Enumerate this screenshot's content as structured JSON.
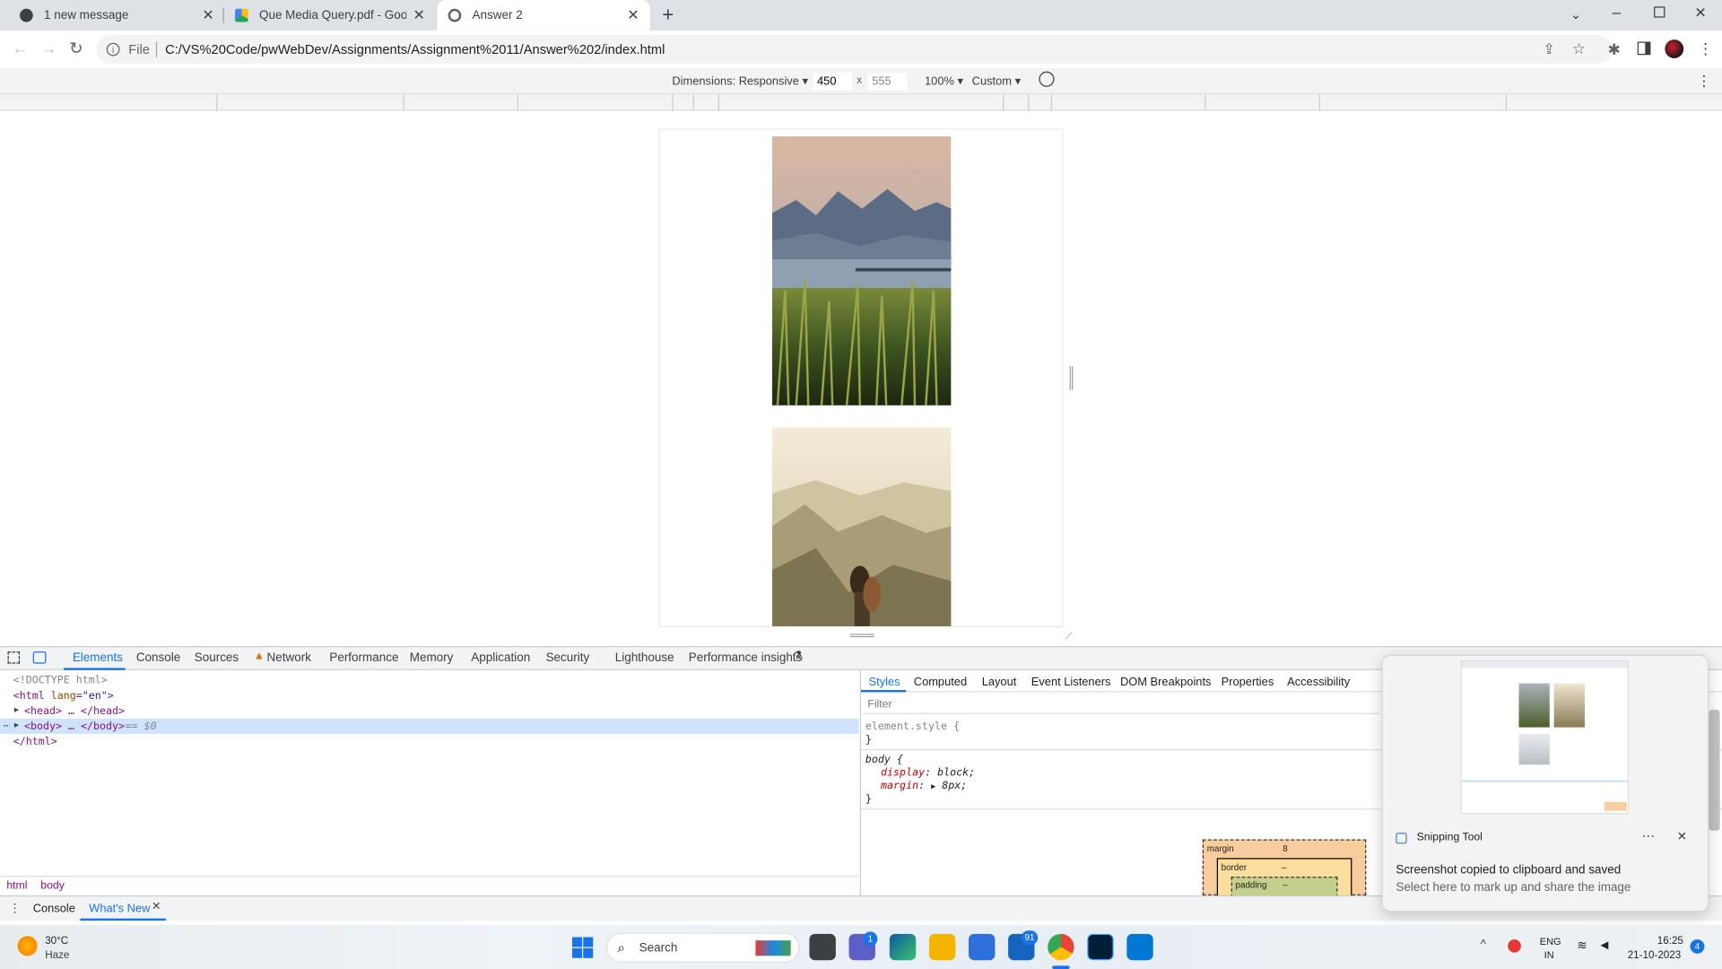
{
  "browser": {
    "tabs": [
      {
        "title": "1 new message",
        "favicon_color": "#3c4043"
      },
      {
        "title": "Que Media Query.pdf - Google D",
        "favicon_color": "#1fa463"
      },
      {
        "title": "Answer 2",
        "favicon_color": "#5f6368"
      }
    ],
    "new_tab_label": "+",
    "address": {
      "scheme_label": "File",
      "url": "C:/VS%20Code/pwWebDev/Assignments/Assignment%2011/Answer%202/index.html"
    }
  },
  "device_toolbar": {
    "dimensions_label": "Dimensions: Responsive",
    "width_value": "450",
    "times": "x",
    "height_value": "555",
    "zoom_label": "100%",
    "throttle_label": "Custom"
  },
  "devtools": {
    "tabs": [
      "Elements",
      "Console",
      "Sources",
      "Network",
      "Performance",
      "Memory",
      "Application",
      "Security",
      "Lighthouse",
      "Performance insights"
    ],
    "elements_tree": {
      "line1": "<!DOCTYPE html>",
      "line2_tag": "<html ",
      "line2_attr": "lang",
      "line2_eq": "=",
      "line2_val": "\"en\"",
      "line2_end": ">",
      "head_line": "<head> … </head>",
      "body_line": "<body> … </body>",
      "body_marker": "== $0",
      "html_close": "</html>"
    },
    "breadcrumbs": [
      "html",
      "body"
    ],
    "styles_tabs": [
      "Styles",
      "Computed",
      "Layout",
      "Event Listeners",
      "DOM Breakpoints",
      "Properties",
      "Accessibility"
    ],
    "filter_placeholder": "Filter",
    "element_style": "element.style {",
    "close_brace": "}",
    "body_rule_selector": "body {",
    "body_rule_prop1": "display",
    "body_rule_val1": "block;",
    "body_rule_prop2": "margin",
    "body_rule_val2": "8px;",
    "box_model": {
      "margin_label": "margin",
      "margin_value": "8",
      "border_label": "border",
      "border_value": "–",
      "padding_label": "padding",
      "padding_value": "–"
    },
    "drawer_tabs": [
      "Console",
      "What's New"
    ]
  },
  "notification": {
    "app_name": "Snipping Tool",
    "title": "Screenshot copied to clipboard and saved",
    "body": "Select here to mark up and share the image"
  },
  "taskbar": {
    "weather_temp": "30°C",
    "weather_desc": "Haze",
    "search_label": "Search",
    "teams_badge": "1",
    "mail_badge": "91",
    "lang_top": "ENG",
    "lang_bottom": "IN",
    "time": "16:25",
    "date": "21-10-2023",
    "notification_count": "4"
  },
  "colors": {
    "accent": "#1a73e8",
    "selected_row": "#cfe3fc",
    "tag": "#881280",
    "attr": "#994500",
    "attr_value": "#1a1aa6",
    "css_prop": "#c80000"
  }
}
